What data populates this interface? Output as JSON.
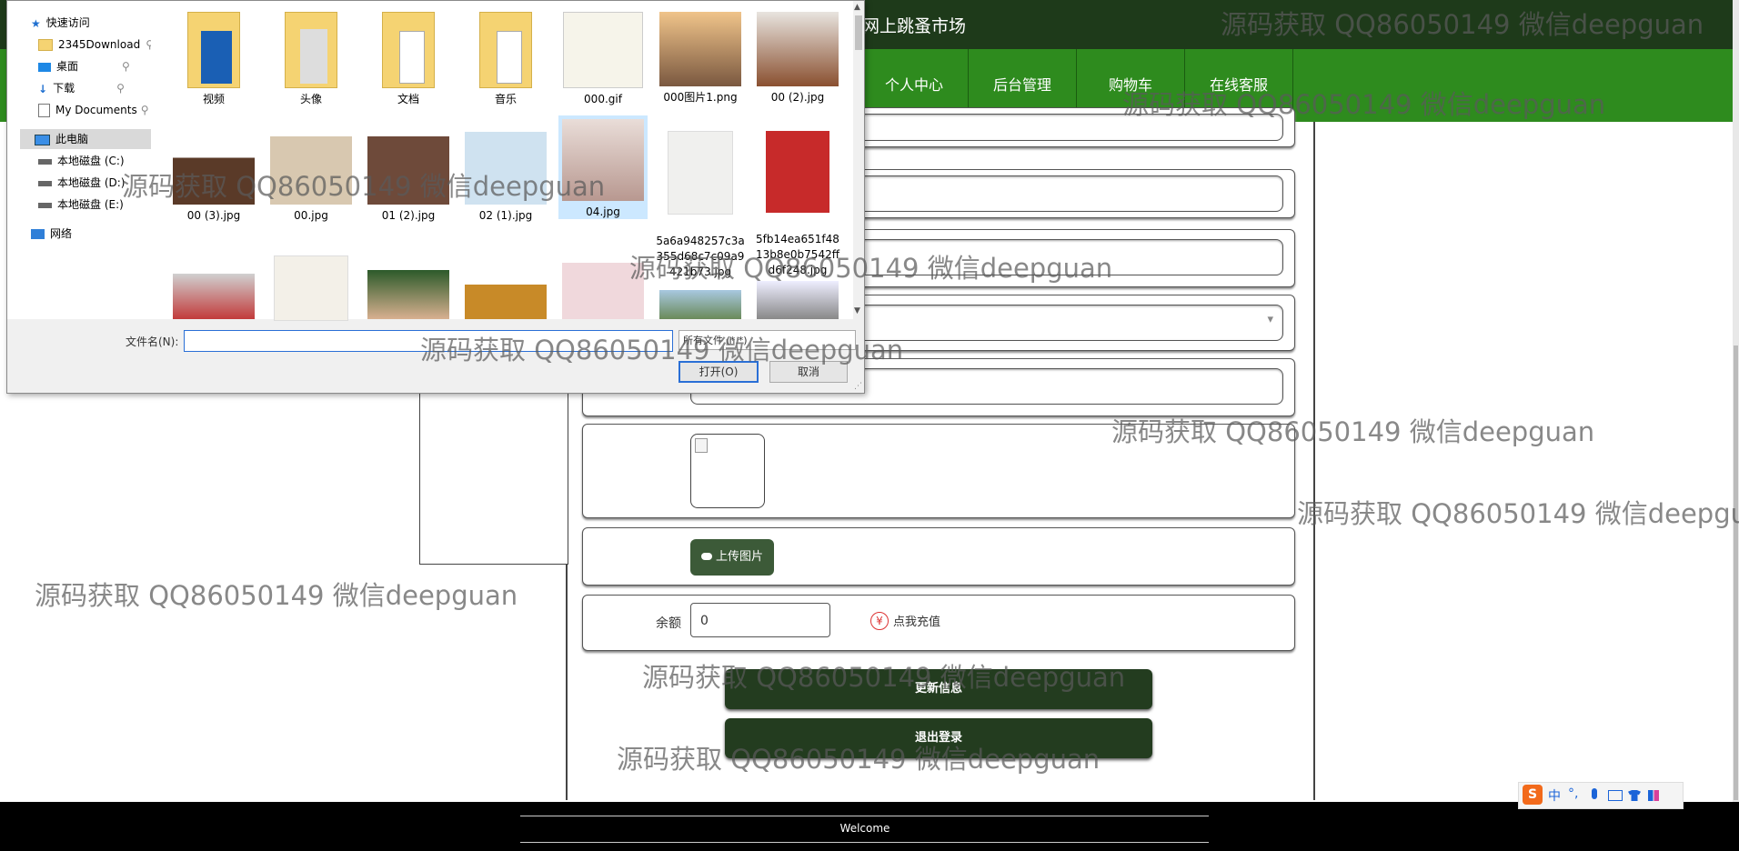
{
  "site": {
    "title": "网上跳蚤市场",
    "nav": [
      "个人中心",
      "后台管理",
      "购物车",
      "在线客服"
    ]
  },
  "form": {
    "select_arrow": "▾",
    "upload_label": "上传图片",
    "balance_label": "余额",
    "balance_value": "0",
    "currency_symbol": "¥",
    "recharge_label": "点我充值",
    "update_button": "更新信息",
    "logout_button": "退出登录"
  },
  "footer": {
    "welcome": "Welcome"
  },
  "ime": {
    "logo": "S",
    "lang": "中",
    "punct": "°,"
  },
  "watermark": "源码获取 QQ86050149 微信deepguan",
  "dialog": {
    "nav": {
      "quick_access": "快速访问",
      "items_quick": [
        "2345Download",
        "桌面",
        "下载",
        "My Documents"
      ],
      "this_pc": "此电脑",
      "drives": [
        "本地磁盘 (C:)",
        "本地磁盘 (D:)",
        "本地磁盘 (E:)"
      ],
      "network": "网络"
    },
    "row1": [
      "视频",
      "头像",
      "文档",
      "音乐",
      "000.gif",
      "000图片1.png",
      "00 (2).jpg"
    ],
    "row2": [
      "00 (3).jpg",
      "00.jpg",
      "01 (2).jpg",
      "02 (1).jpg",
      "04.jpg",
      "5a6a948257c3a\n355d68c7c09a9\n421b73.jpg",
      "5fb14ea651f48\n13b8e0b7542ff\nd6f248.jpg"
    ],
    "filename_label": "文件名(N):",
    "filename_value": "",
    "filetype": "所有文件 (*.*)",
    "open_button": "打开(O)",
    "cancel_button": "取消"
  },
  "colors": {
    "header_dark": "#1e3a1a",
    "nav_green": "#2e8b1e",
    "button_dark": "#233c1f",
    "upload_btn": "#3c5a38",
    "footer": "#000000",
    "dialog_bg": "#f0f0f0",
    "selection": "#cce8ff"
  },
  "icons": [
    "star-icon",
    "folder-icon",
    "pin-icon",
    "desktop-icon",
    "download-icon",
    "document-icon",
    "computer-icon",
    "drive-icon",
    "network-icon",
    "cloud-upload-icon",
    "yen-icon",
    "chevron-down-icon",
    "sogou-icon",
    "mic-icon",
    "keyboard-icon",
    "shirt-icon",
    "grid-icon"
  ]
}
